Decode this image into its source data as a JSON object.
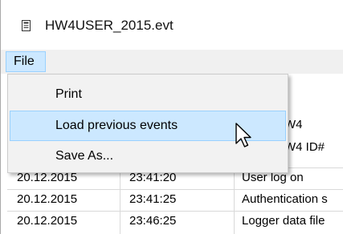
{
  "window": {
    "title": "HW4USER_2015.evt",
    "title_icon": "document-icon"
  },
  "menubar": {
    "file_label": "File"
  },
  "file_menu": {
    "items": [
      {
        "label": "Print"
      },
      {
        "label": "Load previous events"
      },
      {
        "label": "Save As..."
      }
    ],
    "highlighted_index": 1
  },
  "grid": {
    "partial_header": [
      "W4",
      "W4 ID#"
    ],
    "rows": [
      {
        "date": "20.12.2015",
        "time": "23:41:20",
        "event": "User log on"
      },
      {
        "date": "20.12.2015",
        "time": "23:41:25",
        "event": "Authentication s"
      },
      {
        "date": "20.12.2015",
        "time": "23:46:25",
        "event": "Logger data file"
      }
    ]
  },
  "colors": {
    "menu_highlight": "#cce8ff",
    "menu_highlight_border": "#99d1ff",
    "menubar_bg": "#f0f0f0",
    "dropdown_bg": "#f2f2f2"
  }
}
